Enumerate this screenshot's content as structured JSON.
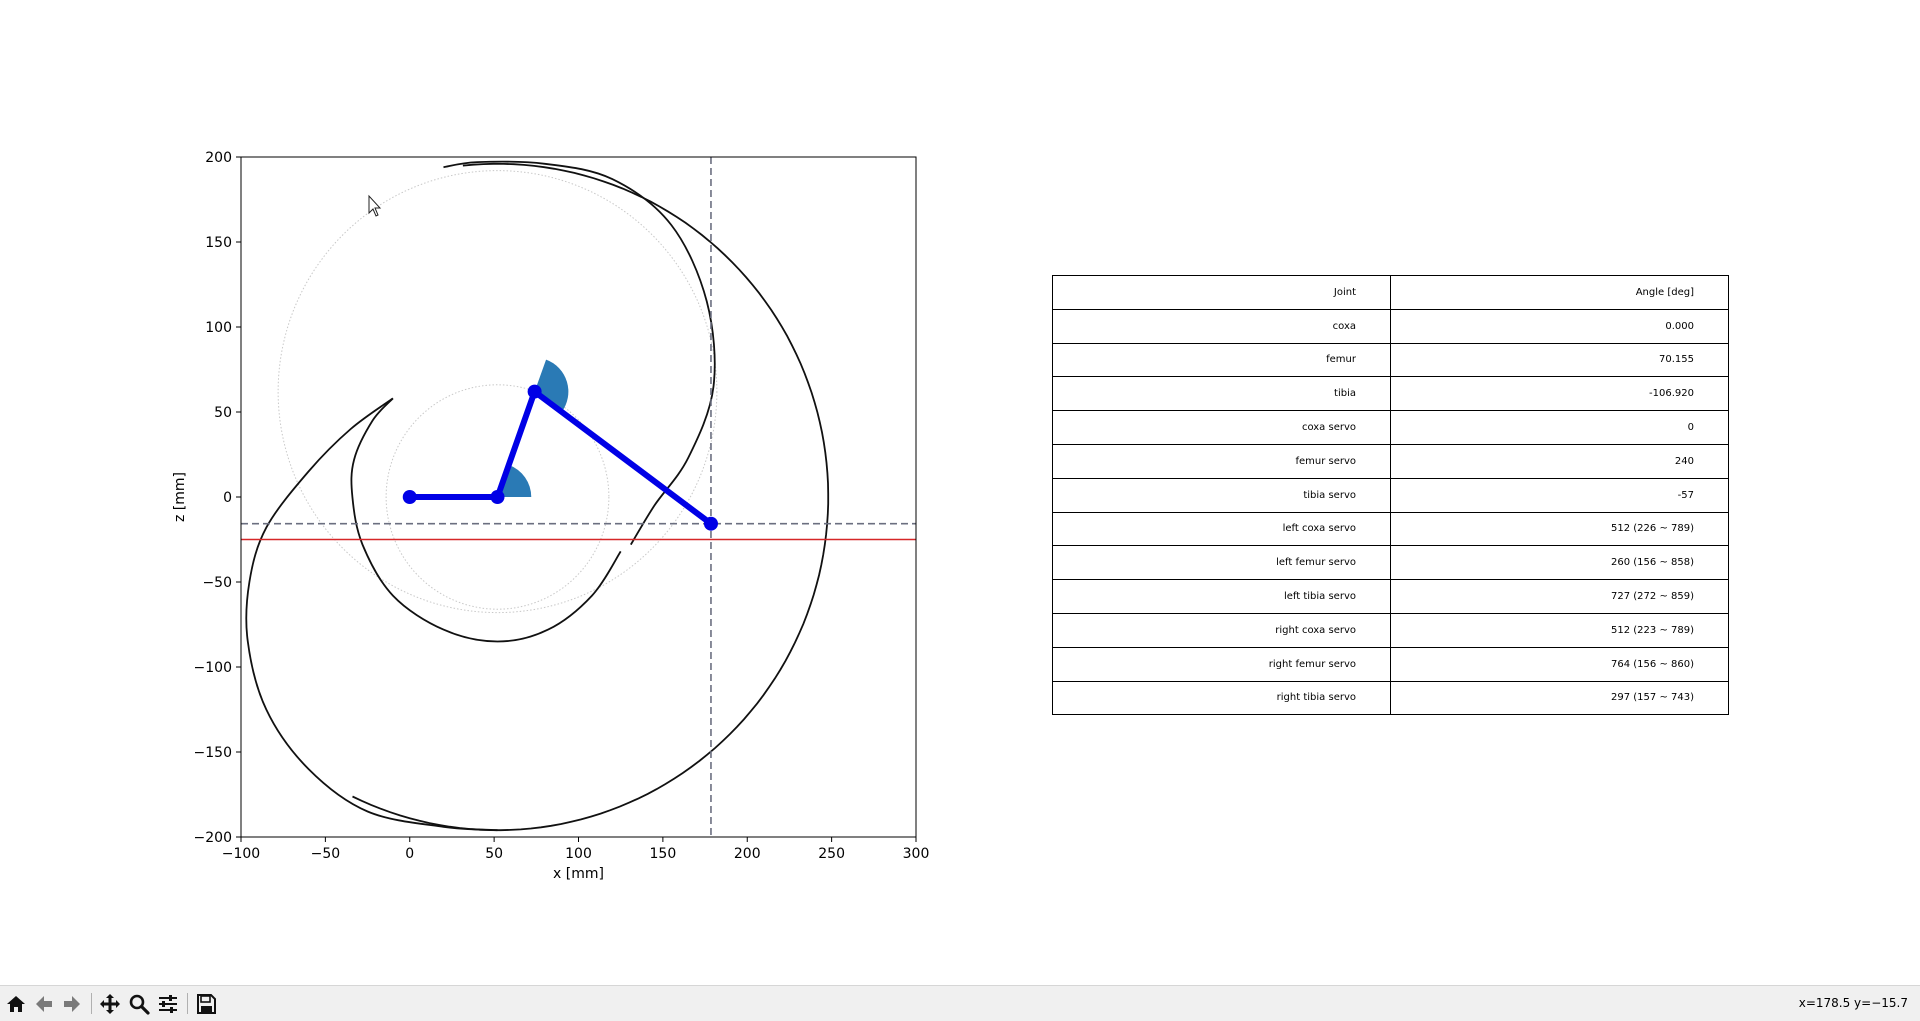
{
  "chart_data": {
    "type": "line",
    "xlabel": "x [mm]",
    "ylabel": "z [mm]",
    "xlim": [
      -100,
      300
    ],
    "ylim": [
      -200,
      200
    ],
    "xticks": [
      -100,
      -50,
      0,
      50,
      100,
      150,
      200,
      250,
      300
    ],
    "yticks": [
      -200,
      -150,
      -100,
      -50,
      0,
      50,
      100,
      150,
      200
    ],
    "xtick_labels": [
      "−100",
      "−50",
      "0",
      "50",
      "100",
      "150",
      "200",
      "250",
      "300"
    ],
    "ytick_labels": [
      "−200",
      "−150",
      "−100",
      "−50",
      "0",
      "50",
      "100",
      "150",
      "200"
    ],
    "grid": false,
    "leg_points": [
      [
        0,
        0
      ],
      [
        52,
        0
      ],
      [
        74,
        62
      ],
      [
        178.5,
        -15.7
      ]
    ],
    "leg_color": "#0000e6",
    "joint_angle_wedges": [
      {
        "center": [
          52,
          0
        ],
        "radius": 20,
        "theta_from": 0,
        "theta_to": 70.155
      },
      {
        "center": [
          74,
          62
        ],
        "radius": 20,
        "theta_from": 70.155,
        "theta_to": -36.765
      }
    ],
    "wedge_color": "#2a7ab5",
    "guide_circles": [
      {
        "center": [
          52,
          0
        ],
        "radius": 66
      },
      {
        "center": [
          52,
          62
        ],
        "radius": 130
      }
    ],
    "workspace_boundary": {
      "outer_arc": {
        "center": [
          52,
          0
        ],
        "radius": 196,
        "from_deg": 96,
        "to_deg": -116
      },
      "lower_spiral": [
        [
          52,
          -196
        ],
        [
          20,
          -194
        ],
        [
          -25,
          -185
        ],
        [
          -60,
          -160
        ],
        [
          -85,
          -125
        ],
        [
          -96,
          -85
        ],
        [
          -95,
          -50
        ],
        [
          -85,
          -18
        ],
        [
          -60,
          15
        ],
        [
          -35,
          40
        ],
        [
          -10,
          58
        ]
      ],
      "return_spiral": [
        [
          -10,
          58
        ],
        [
          -22,
          45
        ],
        [
          -33,
          22
        ],
        [
          -34,
          0
        ],
        [
          -28,
          -28
        ],
        [
          -10,
          -58
        ],
        [
          20,
          -78
        ],
        [
          52,
          -85
        ],
        [
          82,
          -78
        ],
        [
          108,
          -58
        ],
        [
          125,
          -32
        ]
      ],
      "upper_spiral": [
        [
          131,
          -28
        ],
        [
          145,
          -5
        ],
        [
          165,
          23
        ],
        [
          180,
          65
        ],
        [
          176,
          115
        ],
        [
          155,
          160
        ],
        [
          120,
          187
        ],
        [
          80,
          196
        ],
        [
          40,
          197
        ],
        [
          20,
          194
        ]
      ],
      "color": "#111111"
    },
    "ground_line_y": -25,
    "ground_line_color": "#d62728",
    "target_hline_y": -15.7,
    "target_vline_x": 178.5,
    "target_line_color": "#6b6f80"
  },
  "table": {
    "header": [
      "Joint",
      "Angle [deg]"
    ],
    "rows": [
      [
        "coxa",
        "0.000"
      ],
      [
        "femur",
        "70.155"
      ],
      [
        "tibia",
        "-106.920"
      ],
      [
        "coxa servo",
        "0"
      ],
      [
        "femur servo",
        "240"
      ],
      [
        "tibia servo",
        "-57"
      ],
      [
        "left coxa servo",
        "512 (226 ~ 789)"
      ],
      [
        "left femur servo",
        "260 (156 ~ 858)"
      ],
      [
        "left tibia servo",
        "727 (272 ~ 859)"
      ],
      [
        "right coxa servo",
        "512 (223 ~ 789)"
      ],
      [
        "right femur servo",
        "764 (156 ~ 860)"
      ],
      [
        "right tibia servo",
        "297 (157 ~ 743)"
      ]
    ]
  },
  "toolbar": {
    "buttons": [
      {
        "name": "home-button",
        "icon": "home-icon"
      },
      {
        "name": "back-button",
        "icon": "arrow-left-icon"
      },
      {
        "name": "forward-button",
        "icon": "arrow-right-icon"
      },
      {
        "name": "pan-button",
        "icon": "move-icon"
      },
      {
        "name": "zoom-button",
        "icon": "magnifier-icon"
      },
      {
        "name": "configure-subplots-button",
        "icon": "sliders-icon"
      },
      {
        "name": "save-button",
        "icon": "floppy-disk-icon"
      }
    ],
    "coordinates": "x=178.5 y=−15.7"
  }
}
